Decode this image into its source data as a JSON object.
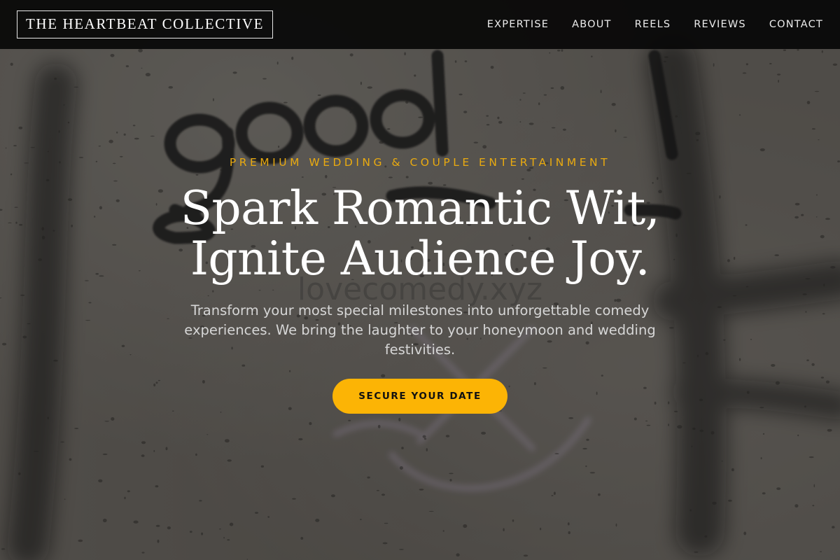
{
  "header": {
    "logo": "THE HEARTBEAT COLLECTIVE",
    "nav": [
      {
        "label": "EXPERTISE"
      },
      {
        "label": "ABOUT"
      },
      {
        "label": "REELS"
      },
      {
        "label": "REVIEWS"
      },
      {
        "label": "CONTACT"
      }
    ]
  },
  "hero": {
    "eyebrow": "PREMIUM WEDDING & COUPLE ENTERTAINMENT",
    "headline_line1": "Spark Romantic Wit,",
    "headline_line2": "Ignite Audience Joy.",
    "subtext": "Transform your most special milestones into unforgettable comedy experiences. We bring the laughter to your honeymoon and wedding festivities.",
    "cta_label": "SECURE YOUR DATE",
    "background": {
      "graffiti_text": "good",
      "watermark": "lovecomedy.xyz"
    }
  },
  "colors": {
    "accent": "#fcb405",
    "eyebrow": "#e9aa10",
    "header_bg": "#080808",
    "heading": "#ffffff"
  }
}
